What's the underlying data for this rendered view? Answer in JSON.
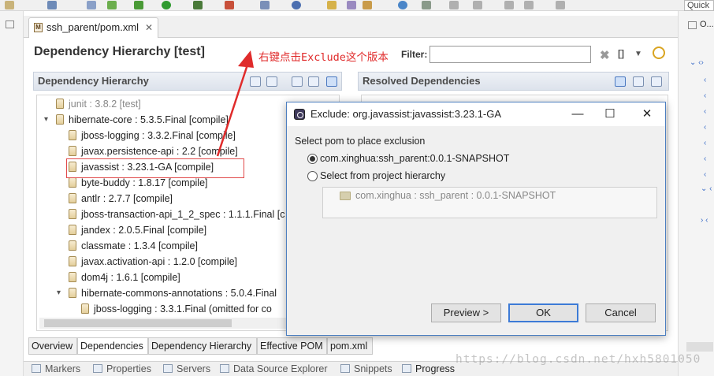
{
  "toolbar": {
    "quick_access": "Quick"
  },
  "editor_tab": {
    "label": "ssh_parent/pom.xml",
    "close": "✕",
    "icon": "maven-pom-icon"
  },
  "page": {
    "title": "Dependency Hierarchy [test]",
    "filter_label": "Filter:",
    "filter_value": ""
  },
  "left_panel": {
    "title": "Dependency Hierarchy"
  },
  "right_panel": {
    "title": "Resolved Dependencies"
  },
  "annotation": {
    "text": "右键点击Exclude这个版本",
    "color": "#e02b2b"
  },
  "tree": [
    {
      "label": "junit : 3.8.2 [test]",
      "level": 0,
      "muted": true,
      "toggle": ""
    },
    {
      "label": "hibernate-core : 5.3.5.Final [compile]",
      "level": 0,
      "toggle": "v"
    },
    {
      "label": "jboss-logging : 3.3.2.Final [compile]",
      "level": 1
    },
    {
      "label": "javax.persistence-api : 2.2 [compile]",
      "level": 1
    },
    {
      "label": "javassist : 3.23.1-GA [compile]",
      "level": 1,
      "highlighted": true
    },
    {
      "label": "byte-buddy : 1.8.17 [compile]",
      "level": 1
    },
    {
      "label": "antlr : 2.7.7 [compile]",
      "level": 1
    },
    {
      "label": "jboss-transaction-api_1_2_spec : 1.1.1.Final [c",
      "level": 1
    },
    {
      "label": "jandex : 2.0.5.Final [compile]",
      "level": 1
    },
    {
      "label": "classmate : 1.3.4 [compile]",
      "level": 1
    },
    {
      "label": "javax.activation-api : 1.2.0 [compile]",
      "level": 1
    },
    {
      "label": "dom4j : 1.6.1 [compile]",
      "level": 1
    },
    {
      "label": "hibernate-commons-annotations : 5.0.4.Final",
      "level": 1,
      "toggle": "v"
    },
    {
      "label": "jboss-logging : 3.3.1.Final (omitted for co",
      "level": 2
    }
  ],
  "bottom_tabs": [
    "Overview",
    "Dependencies",
    "Dependency Hierarchy",
    "Effective POM",
    "pom.xml"
  ],
  "selected_bottom_tab": "Dependencies",
  "views": [
    {
      "label": "Markers",
      "icon": "markers-icon"
    },
    {
      "label": "Properties",
      "icon": "properties-icon"
    },
    {
      "label": "Servers",
      "icon": "servers-icon"
    },
    {
      "label": "Data Source Explorer",
      "icon": "data-source-icon"
    },
    {
      "label": "Snippets",
      "icon": "snippets-icon"
    },
    {
      "label": "Progress",
      "icon": "progress-icon"
    }
  ],
  "watermark": "https://blog.csdn.net/hxh5801050",
  "dialog": {
    "title": "Exclude: org.javassist:javassist:3.23.1-GA",
    "prompt": "Select pom to place exclusion",
    "option1": "com.xinghua:ssh_parent:0.0.1-SNAPSHOT",
    "option1_selected": true,
    "option2": "Select from project hierarchy",
    "hierarchy_item": "com.xinghua : ssh_parent : 0.0.1-SNAPSHOT",
    "preview_label": "Preview >",
    "ok_label": "OK",
    "cancel_label": "Cancel",
    "minimize": "—",
    "maximize": "☐",
    "close": "✕"
  }
}
